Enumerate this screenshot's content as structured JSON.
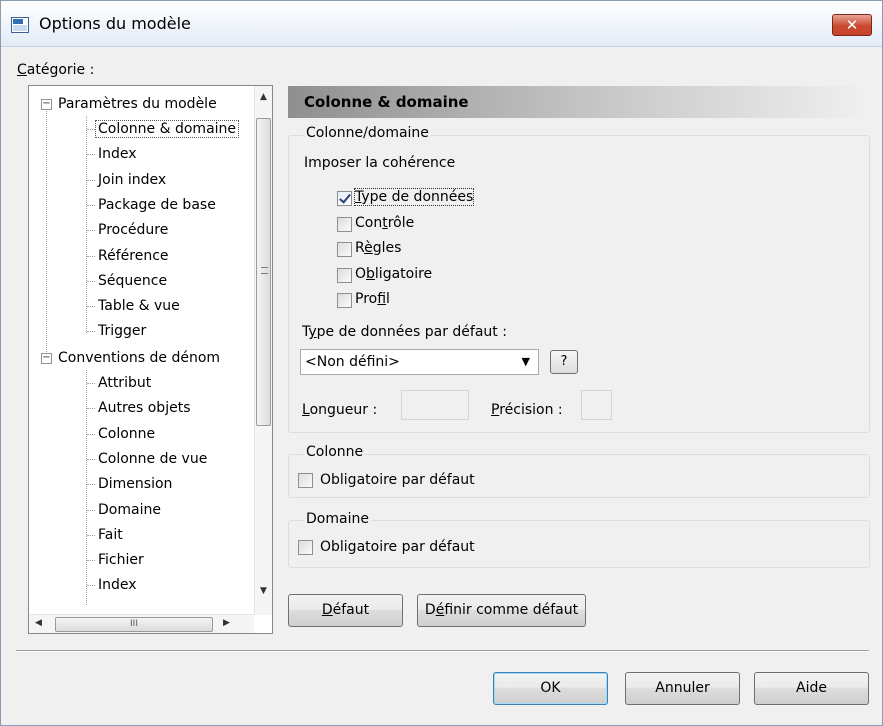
{
  "window": {
    "title": "Options du modèle",
    "close_symbol": "✕"
  },
  "category": {
    "label_prefix": "C",
    "label_rest": "atégorie :"
  },
  "tree": {
    "group1_label": "Paramètres du modèle",
    "group1_items": [
      "Colonne & domaine",
      "Index",
      "Join index",
      "Package de base",
      "Procédure",
      "Référence",
      "Séquence",
      "Table & vue",
      "Trigger"
    ],
    "group2_label": "Conventions de dénom",
    "group2_items": [
      "Attribut",
      "Autres objets",
      "Colonne",
      "Colonne de vue",
      "Dimension",
      "Domaine",
      "Fait",
      "Fichier",
      "Index"
    ],
    "selected": "Colonne & domaine",
    "hscroll_grip": "III"
  },
  "panel": {
    "header": "Colonne & domaine",
    "group_coldom": "Colonne/domaine",
    "enforce_label": "Imposer la cohérence",
    "checkboxes": [
      {
        "pre": "",
        "ul": "T",
        "post": "ype de données",
        "checked": true
      },
      {
        "pre": "Con",
        "ul": "t",
        "post": "rôle",
        "checked": false
      },
      {
        "pre": "R",
        "ul": "è",
        "post": "gles",
        "checked": false
      },
      {
        "pre": "O",
        "ul": "b",
        "post": "ligatoire",
        "checked": false
      },
      {
        "pre": "Pro",
        "ul": "f",
        "post": "il",
        "checked": false
      }
    ],
    "default_type_pre": "T",
    "default_type_ul": "y",
    "default_type_post": "pe de données par défaut :",
    "default_type_value": "<Non défini>",
    "help_label": "?",
    "length_ul": "L",
    "length_rest": "ongueur :",
    "precision_ul": "P",
    "precision_rest": "récision :",
    "group_colonne": "Colonne",
    "colonne_mandatory": "Obligatoire par défaut",
    "group_domaine": "Domaine",
    "domaine_mandatory": "Obligatoire par défaut"
  },
  "buttons": {
    "default_ul": "D",
    "default_rest": "éfaut",
    "set_default_pre": "D",
    "set_default_ul": "é",
    "set_default_post": "finir comme défaut",
    "ok": "OK",
    "cancel": "Annuler",
    "help": "Aide"
  }
}
